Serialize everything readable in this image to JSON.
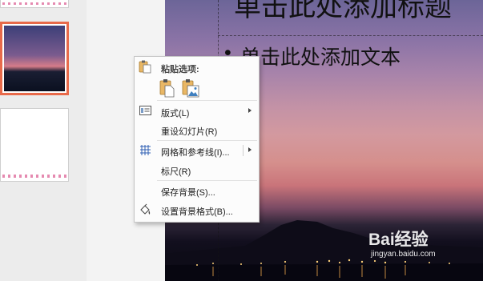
{
  "slide": {
    "title_text": "单击此处添加标题",
    "body_text": "单击此处添加文本",
    "bullet": "•"
  },
  "context_menu": {
    "paste_options_label": "粘贴选项:",
    "items": [
      {
        "label": "版式(L)",
        "icon": "layout-icon",
        "has_submenu": true
      },
      {
        "label": "重设幻灯片(R)",
        "icon": "",
        "has_submenu": false
      },
      {
        "label": "网格和参考线(I)...",
        "icon": "grid-icon",
        "has_submenu": true
      },
      {
        "label": "标尺(R)",
        "icon": "",
        "has_submenu": false
      },
      {
        "label": "保存背景(S)...",
        "icon": "",
        "has_submenu": false
      },
      {
        "label": "设置背景格式(B)...",
        "icon": "format-background-icon",
        "has_submenu": false
      }
    ]
  },
  "watermark": {
    "brand": "Bai经验",
    "url": "jingyan.baidu.com"
  },
  "colors": {
    "selected_thumb_border": "#e86a4a",
    "menu_background": "#fcfcfc",
    "paste_icon": "#e9b765"
  }
}
